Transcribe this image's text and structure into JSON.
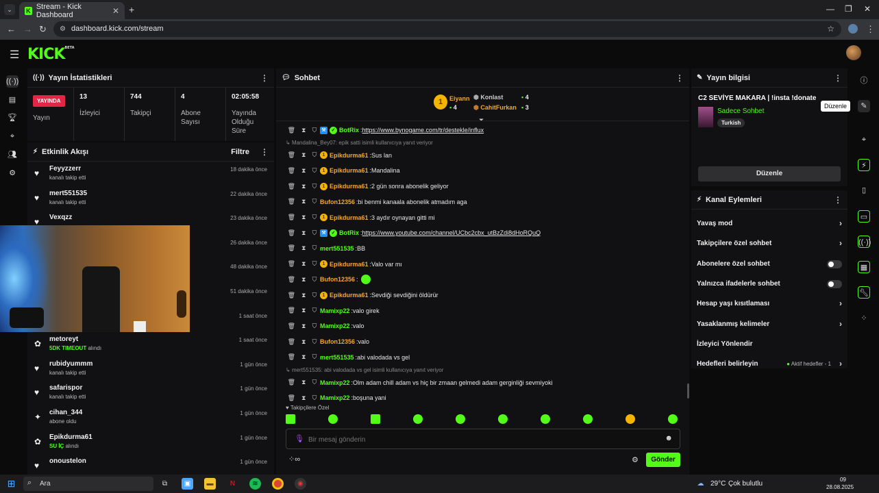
{
  "browser": {
    "tab_title": "Stream - Kick Dashboard",
    "url": "dashboard.kick.com/stream"
  },
  "header": {
    "logo": "KICK",
    "logo_badge": "BETA"
  },
  "stats_panel": {
    "title": "Yayın İstatistikleri",
    "live_badge": "YAYINDA",
    "items": [
      {
        "value": "",
        "label": "Yayın"
      },
      {
        "value": "13",
        "label": "İzleyici"
      },
      {
        "value": "744",
        "label": "Takipçi"
      },
      {
        "value": "4",
        "label": "Abone Sayısı"
      },
      {
        "value": "02:05:58",
        "label": "Yayında Olduğu Süre"
      }
    ]
  },
  "activity": {
    "title": "Etkinlik Akışı",
    "filter": "Filtre",
    "items": [
      {
        "icon": "heart",
        "name": "Feyyzzerr",
        "sub": "kanalı takip etti",
        "time": "18 dakika önce"
      },
      {
        "icon": "heart",
        "name": "mert551535",
        "sub": "kanalı takip etti",
        "time": "22 dakika önce"
      },
      {
        "icon": "heart",
        "name": "Vexqzz",
        "sub": "",
        "time": "23 dakika önce"
      },
      {
        "icon": "heart",
        "name": "",
        "sub": "",
        "time": "26 dakika önce"
      },
      {
        "icon": "heart",
        "name": "",
        "sub": "",
        "time": "48 dakika önce"
      },
      {
        "icon": "heart",
        "name": "",
        "sub": "",
        "time": "51 dakika önce"
      },
      {
        "icon": "heart",
        "name": "",
        "sub": "",
        "time": "1 saat önce"
      },
      {
        "icon": "gift",
        "name": "metoreyt",
        "sub_hl": "5DK TIMEOUT",
        "sub": "alındı",
        "time": "1 saat önce"
      },
      {
        "icon": "heart",
        "name": "rubidyummm",
        "sub": "kanalı takip etti",
        "time": "1 gün önce"
      },
      {
        "icon": "heart",
        "name": "safarispor",
        "sub": "kanalı takip etti",
        "time": "1 gün önce"
      },
      {
        "icon": "star",
        "name": "cihan_344",
        "sub": "abone oldu",
        "time": "1 gün önce"
      },
      {
        "icon": "gift",
        "name": "Epikdurma61",
        "sub_hl": "SU İÇ",
        "sub": "alındı",
        "time": "1 gün önce"
      },
      {
        "icon": "heart",
        "name": "onoustelon",
        "sub": "",
        "time": "1 gün önce"
      }
    ]
  },
  "chat": {
    "title": "Sohbet",
    "leaderboard": [
      {
        "rank": "1",
        "name": "Eiyann",
        "count": "4"
      },
      {
        "name": "Konlast",
        "count": "4"
      },
      {
        "name": "CahitFurkan",
        "count": "3"
      }
    ],
    "messages": [
      {
        "user": "BotRix",
        "color": "#53fc18",
        "badges": "bot",
        "text": "",
        "link": "https://www.bynogame.com/tr/destekle/influx"
      },
      {
        "reply": "Mandalina_Bey07: epik satti isimli kullanıcıya yanıt veriyor"
      },
      {
        "user": "Epikdurma61",
        "color": "#f4a630",
        "badges": "sub",
        "text": "Sus lan"
      },
      {
        "user": "Epikdurma61",
        "color": "#f4a630",
        "badges": "sub",
        "text": "Mandalina"
      },
      {
        "user": "Epikdurma61",
        "color": "#f4a630",
        "badges": "sub",
        "text": "2 gün sonra abonelik geliyor"
      },
      {
        "user": "Bufon12356",
        "color": "#f4a630",
        "badges": "",
        "text": "bi benmi kanaala abonelik atmadım aga"
      },
      {
        "user": "Epikdurma61",
        "color": "#f4a630",
        "badges": "sub",
        "text": "3 aydır oynayan gitti mi"
      },
      {
        "user": "BotRix",
        "color": "#53fc18",
        "badges": "bot",
        "text": "",
        "link": "https://www.youtube.com/channel/UCbc2cbx_utBzZdi8dHoRQuQ"
      },
      {
        "user": "mert551535",
        "color": "#53fc18",
        "badges": "",
        "text": "BB"
      },
      {
        "user": "Epikdurma61",
        "color": "#f4a630",
        "badges": "sub",
        "text": "Valo var mı"
      },
      {
        "user": "Bufon12356",
        "color": "#f4a630",
        "badges": "",
        "text": "",
        "emote": true
      },
      {
        "user": "Epikdurma61",
        "color": "#f4a630",
        "badges": "sub",
        "text": "Sevdiği sevdiğini öldürür"
      },
      {
        "user": "Mamixp22",
        "color": "#53fc18",
        "badges": "",
        "text": "valo girek"
      },
      {
        "user": "Mamixp22",
        "color": "#53fc18",
        "badges": "",
        "text": "valo"
      },
      {
        "user": "Bufon12356",
        "color": "#f4a630",
        "badges": "",
        "text": "valo"
      },
      {
        "user": "mert551535",
        "color": "#53fc18",
        "badges": "",
        "text": "abi valodada vs gel"
      },
      {
        "reply": "mert551535: abi valodada vs gel isimli kullanıcıya yanıt veriyor"
      },
      {
        "user": "Mamixp22",
        "color": "#53fc18",
        "badges": "",
        "text": "Olm adam chill adam vs hiç bir zmaan gelmedi adam gerginliği sevmiyoki"
      },
      {
        "user": "Mamixp22",
        "color": "#53fc18",
        "badges": "",
        "text": "boşuna yani"
      }
    ],
    "followers_only": "Takipçilere Özel",
    "placeholder": "Bir mesaj gönderin",
    "send": "Gönder"
  },
  "stream_info": {
    "title": "Yayın bilgisi",
    "stream_title": "C2 SEVİYE MAKARA | !insta !donate",
    "category": "Sadece Sohbet",
    "language": "Turkish",
    "edit": "Düzenle",
    "tooltip": "Düzenle"
  },
  "channel_actions": {
    "title": "Kanal Eylemleri",
    "items": [
      {
        "label": "Yavaş mod",
        "control": "chevron"
      },
      {
        "label": "Takipçilere özel sohbet",
        "control": "chevron"
      },
      {
        "label": "Abonelere özel sohbet",
        "control": "toggle"
      },
      {
        "label": "Yalnızca ifadelerle sohbet",
        "control": "toggle"
      },
      {
        "label": "Hesap yaşı kısıtlaması",
        "control": "chevron"
      },
      {
        "label": "Yasaklanmış kelimeler",
        "control": "chevron"
      },
      {
        "label": "İzleyici Yönlendir",
        "control": "none"
      },
      {
        "label": "Hedefleri belirleyin",
        "control": "chevron",
        "extra": "Aktif hedefler - 1"
      }
    ]
  },
  "taskbar": {
    "search": "Ara",
    "weather": "29°C",
    "weather_text": "Çok bulutlu",
    "time": "09",
    "date": "28.08.2025"
  },
  "colors": {
    "accent": "#53fc18",
    "live": "#e32546",
    "gold": "#f4a630"
  }
}
